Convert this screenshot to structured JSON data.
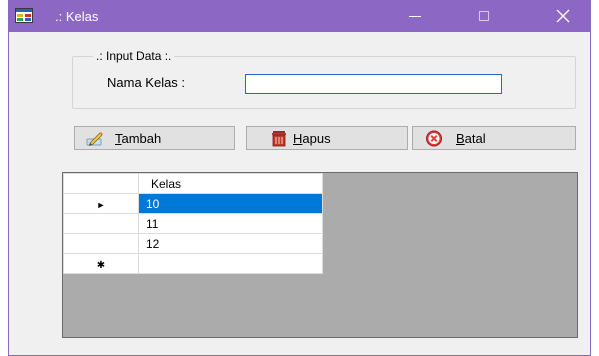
{
  "window": {
    "title": ".: Kelas",
    "accent_color": "#8c68c4",
    "icon": "form-app-icon"
  },
  "input_group": {
    "legend": ".: Input Data :.",
    "field_label": "Nama Kelas :",
    "field_value": ""
  },
  "buttons": {
    "tambah": {
      "mnemonic": "T",
      "rest": "ambah",
      "icon": "pencil-icon"
    },
    "hapus": {
      "mnemonic": "H",
      "rest": "apus",
      "icon": "trash-icon"
    },
    "batal": {
      "mnemonic": "B",
      "rest": "atal",
      "icon": "cancel-icon"
    }
  },
  "grid": {
    "column_header": "Kelas",
    "rows": [
      {
        "value": "10",
        "selected": true,
        "indicator": "►"
      },
      {
        "value": "11",
        "selected": false,
        "indicator": ""
      },
      {
        "value": "12",
        "selected": false,
        "indicator": ""
      }
    ],
    "new_row_indicator": "✱",
    "selection_color": "#0078d7"
  }
}
